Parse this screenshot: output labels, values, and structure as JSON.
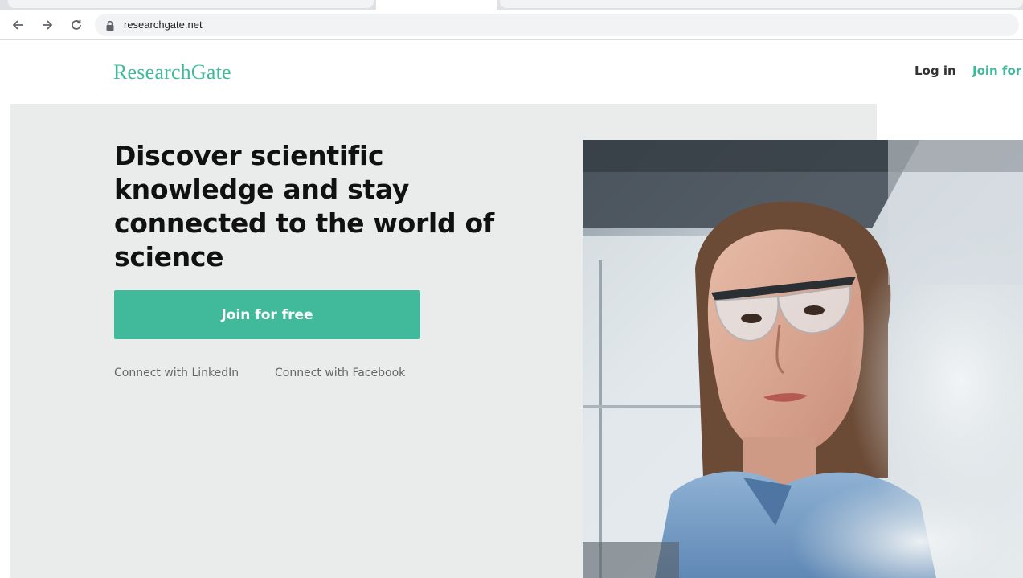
{
  "browser": {
    "url": "researchgate.net",
    "nav": {
      "back_icon": "arrow-left-icon",
      "forward_icon": "arrow-right-icon",
      "reload_icon": "reload-icon",
      "lock_icon": "lock-icon"
    }
  },
  "header": {
    "logo": "ResearchGate",
    "login": "Log in",
    "join": "Join for free"
  },
  "hero": {
    "headline": "Discover scientific knowledge and stay connected to the world of science",
    "cta": "Join for free",
    "linkedin": "Connect with LinkedIn",
    "facebook": "Connect with Facebook"
  },
  "colors": {
    "brand": "#40ba9b",
    "hero_bg": "#e9eceb",
    "headline": "#111111"
  }
}
